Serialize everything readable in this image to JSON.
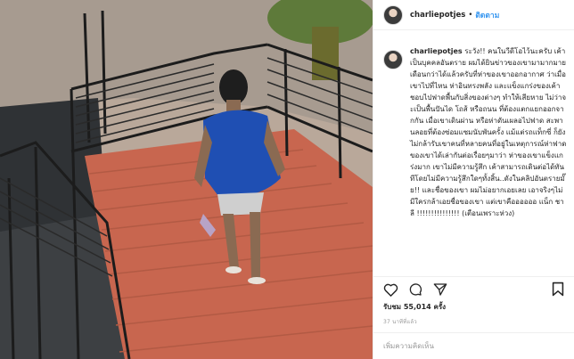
{
  "post": {
    "username": "charliepotjes",
    "separator": "•",
    "follow_label": "ติดตาม",
    "caption_user": "charliepotjes",
    "caption_text": " ระวัง!! คนในวีดีโอไว้นะครับ เค้าเป็นบุคคลอันตราย ผมได้ยินข่าวของเขามามากมาย เดือนกว่าได้แล้วครับที่ห่าของเขาออกอากาศ ว่าเมื่อเขาไปที่ไหน ห่าอินทรงพลัง และแข็งแกร่งของเค้า ชอบไปฟาดพื้นกับสิ่งของต่างๆ ทำให้เสียหาย ไม่ว่าจะเป็นพื้นปันได โถส้ หรือถนน ที่ต้องแตกแยกออกจากกัน เมื่อเขาเดินผ่าน หรือห่าดันเผลอไปฟาด สะพานลอยที่ต้องซ่อมแซมนับพันครั้ง แม้แต่รถแท็กซี่ ก็ยังไม่กล้ารับเขาคนที่หลายคนที่อยู่ในเหตุการณ์ห่าฟาดของเขาได้เล่ากันต่อเรื่อยๆมาว่า ห่าของเขาแข็งแกร่งมาก เขาไม่มีความรู้สึก เค้าสามารถเดินต่อได้ทันทีโดยไม่มีความรู้สึกใดๆทั้งสิ้น..ดังในคลิปอันตรายมั๊ย!! และชื่อของเขา ผมไม่อยากเอยเลย เอาจริงๆไม่มีใครกล้าเอยชื่อของเขา แต่เขาคืออออออ แน็ก ชาลี !!!!!!!!!!!!!!! (เตือนเพราะห่วง)",
    "views": "รับชม 55,014 ครั้ง",
    "time_ago": "37 นาทีที่แล้ว",
    "comment_placeholder": "เพิ่มความคิดเห็น"
  },
  "icons": {
    "like": "heart-icon",
    "comment": "comment-icon",
    "share": "share-icon",
    "save": "bookmark-icon"
  },
  "colors": {
    "follow": "#3897f0",
    "floor": "#c8664f",
    "shirt": "#1f4fb3"
  }
}
